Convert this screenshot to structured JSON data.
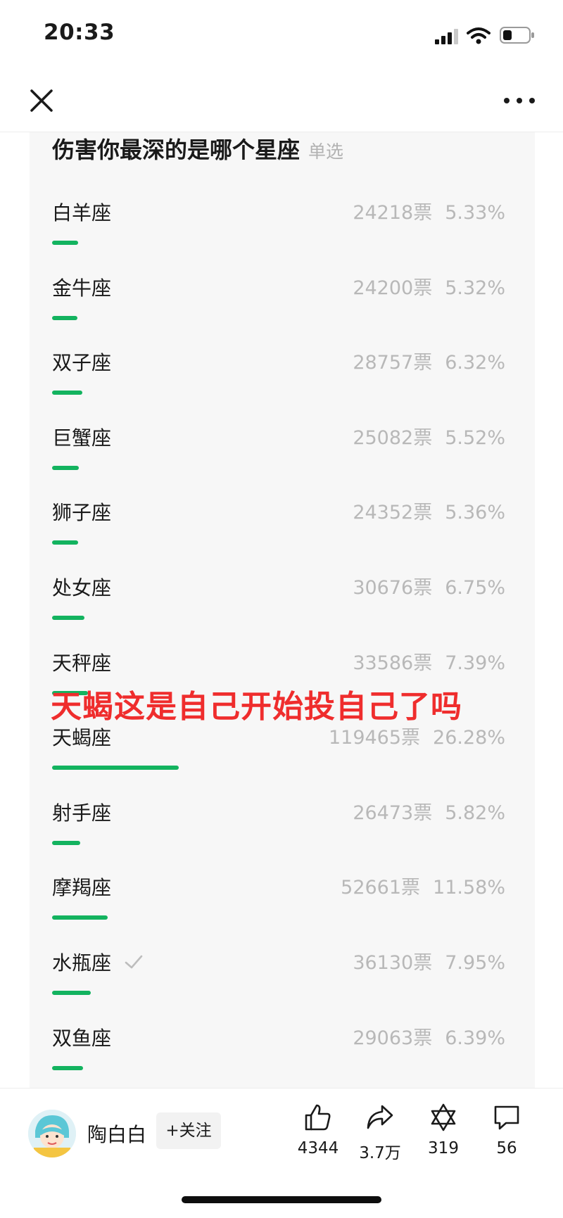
{
  "status_bar": {
    "time": "20:33"
  },
  "poll": {
    "title": "伤害你最深的是哪个星座",
    "type_label": "单选",
    "options": [
      {
        "label": "白羊座",
        "votes": "24218票",
        "percent": "5.33%",
        "share": 5.33,
        "checked": false
      },
      {
        "label": "金牛座",
        "votes": "24200票",
        "percent": "5.32%",
        "share": 5.32,
        "checked": false
      },
      {
        "label": "双子座",
        "votes": "28757票",
        "percent": "6.32%",
        "share": 6.32,
        "checked": false
      },
      {
        "label": "巨蟹座",
        "votes": "25082票",
        "percent": "5.52%",
        "share": 5.52,
        "checked": false
      },
      {
        "label": "狮子座",
        "votes": "24352票",
        "percent": "5.36%",
        "share": 5.36,
        "checked": false
      },
      {
        "label": "处女座",
        "votes": "30676票",
        "percent": "6.75%",
        "share": 6.75,
        "checked": false
      },
      {
        "label": "天秤座",
        "votes": "33586票",
        "percent": "7.39%",
        "share": 7.39,
        "checked": false
      },
      {
        "label": "天蝎座",
        "votes": "119465票",
        "percent": "26.28%",
        "share": 26.28,
        "checked": false
      },
      {
        "label": "射手座",
        "votes": "26473票",
        "percent": "5.82%",
        "share": 5.82,
        "checked": false
      },
      {
        "label": "摩羯座",
        "votes": "52661票",
        "percent": "11.58%",
        "share": 11.58,
        "checked": false
      },
      {
        "label": "水瓶座",
        "votes": "36130票",
        "percent": "7.95%",
        "share": 7.95,
        "checked": true
      },
      {
        "label": "双鱼座",
        "votes": "29063票",
        "percent": "6.39%",
        "share": 6.39,
        "checked": false
      }
    ]
  },
  "overlay_caption": "天蝎这是自己开始投自己了吗",
  "author": {
    "name": "陶白白",
    "follow_label": "+关注"
  },
  "actions": {
    "like_count": "4344",
    "share_count": "3.7万",
    "favorite_count": "319",
    "comment_count": "56"
  },
  "colors": {
    "bar_green": "#13b35f",
    "caption_red": "#ef2d2d",
    "stat_gray": "#b8b8b8"
  }
}
